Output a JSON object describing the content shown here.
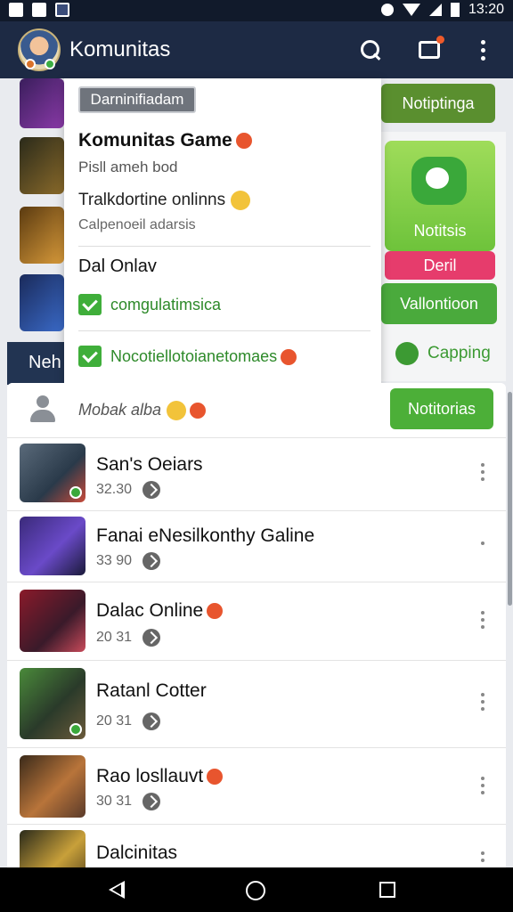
{
  "status_bar": {
    "time": "13:20"
  },
  "app_bar": {
    "title": "Komunitas"
  },
  "background": {
    "top_button": "Notiptinga",
    "tile_label": "Notitsis",
    "pink_button": "Deril",
    "green_button": "Vallontioon",
    "capping_label": "Capping",
    "dark_tab": "Neh"
  },
  "popup": {
    "chip": "Darninifiadam",
    "title": "Komunitas Game",
    "subtitle": "Pisll ameh bod",
    "line": "Tralkdortine onlinns",
    "line_sub": "Calpenoeil adarsis",
    "section": "Dal Onlav",
    "check1": "comgulatimsica",
    "check2": "Nocotiellotoianetomaes"
  },
  "search_row": {
    "text": "Mobak alba",
    "button": "Notitorias"
  },
  "list": [
    {
      "title": "San's Oeiars",
      "meta": "32.30",
      "has_badge": true
    },
    {
      "title": "Fanai eNesilkonthy Galine",
      "meta": "33 90",
      "has_badge": false
    },
    {
      "title": "Dalac Online",
      "meta": "20 31",
      "has_badge": false
    },
    {
      "title": "Ratanl Cotter",
      "meta": "20 31",
      "has_badge": true
    },
    {
      "title": "Rao losllauvt",
      "meta": "30 31",
      "has_badge": false
    },
    {
      "title": "Dalcinitas",
      "meta": "",
      "has_badge": false
    }
  ],
  "colors": {
    "appbar": "#1d2a44",
    "accent_green": "#4caf38",
    "accent_pink": "#e63c6c"
  },
  "icons": [
    "search-icon",
    "cast-icon",
    "more-icon",
    "user-icon",
    "back-icon",
    "home-icon",
    "recent-icon"
  ]
}
